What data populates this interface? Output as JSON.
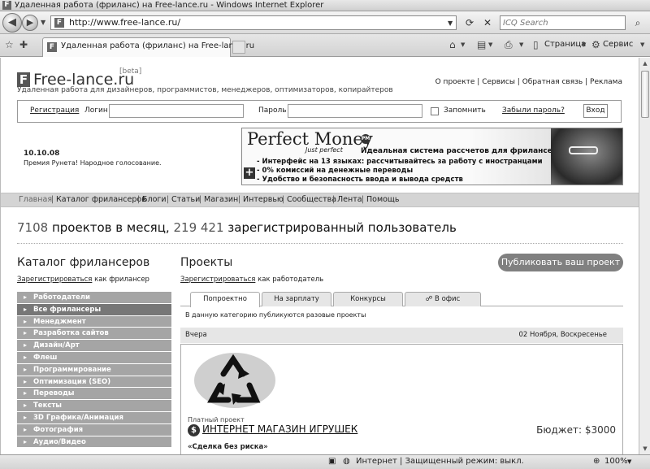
{
  "window": {
    "title": "Удаленная работа (фриланс) на Free-lance.ru - Windows Internet Explorer"
  },
  "address": {
    "url": "http://www.free-lance.ru/",
    "search_placeholder": "ICQ Search"
  },
  "tab": {
    "label": "Удаленная работа (фриланс) на Free-lance.ru"
  },
  "commands": {
    "page": "Страница",
    "tools": "Сервис"
  },
  "site": {
    "logo_letter": "F",
    "logo_name": "Free-lance.ru",
    "beta": "[beta]",
    "tagline": "Удаленная работа для дизайнеров, программистов, менеджеров, оптимизаторов, копирайтеров",
    "top_links": [
      "О проекте",
      "Сервисы",
      "Обратная связь",
      "Реклама"
    ]
  },
  "login": {
    "register": "Регистрация",
    "login_label": "Логин",
    "password_label": "Пароль",
    "remember": "Запомнить",
    "forgot": "Забыли пароль?",
    "enter": "Вход"
  },
  "news": {
    "date": "10.10.08",
    "text": "Премия Рунета! Народное голосование."
  },
  "banner": {
    "title": "Perfect Money",
    "badge": "PM",
    "subtitle": "Just perfect",
    "headline": "Идеальная система рассчетов для фрилансеров",
    "bullets": [
      "- Интерфейс на 13 языках: рассчитывайтесь за работу с иностранцами",
      "- 0% комиссий на денежные переводы",
      "- Удобство и безопасность ввода и вывода средств"
    ]
  },
  "nav": {
    "items": [
      "Главная",
      "Каталог фрилансеров",
      "Блоги",
      "Статьи",
      "Магазин",
      "Интервью",
      "Сообщества",
      "Лента",
      "Помощь"
    ]
  },
  "stats": {
    "projects_count": "7108",
    "projects_text": "проектов в месяц,",
    "users_count": "219 421",
    "users_text": "зарегистрированный пользователь"
  },
  "catalog": {
    "title": "Каталог фрилансеров",
    "register_link": "Зарегистрироваться",
    "register_suffix": "как фрилансер",
    "categories": [
      "Работодатели",
      "Все фрилансеры",
      "Менеджмент",
      "Разработка сайтов",
      "Дизайн/Арт",
      "Флеш",
      "Программирование",
      "Оптимизация (SEO)",
      "Переводы",
      "Тексты",
      "3D Графика/Анимация",
      "Фотография",
      "Аудио/Видео"
    ]
  },
  "projects": {
    "title": "Проекты",
    "register_link": "Зарегистрироваться",
    "register_suffix": "как работодатель",
    "publish": "Публиковать ваш проект",
    "tabs": [
      "Попроектно",
      "На зарплату",
      "Конкурсы",
      "В офис"
    ],
    "tab_note": "В данную категорию публикуются разовые проекты",
    "day_left": "Вчера",
    "day_right": "02 Ноября, Воскресенье",
    "item": {
      "paid_label": "Платный проект",
      "dollar": "$",
      "title": "ИНТЕРНЕТ МАГАЗИН ИГРУШЕК",
      "budget": "Бюджет: $3000",
      "deal": "«Сделка без риска»"
    }
  },
  "status": {
    "zone": "Интернет | Защищенный режим: выкл.",
    "zoom": "100%"
  }
}
